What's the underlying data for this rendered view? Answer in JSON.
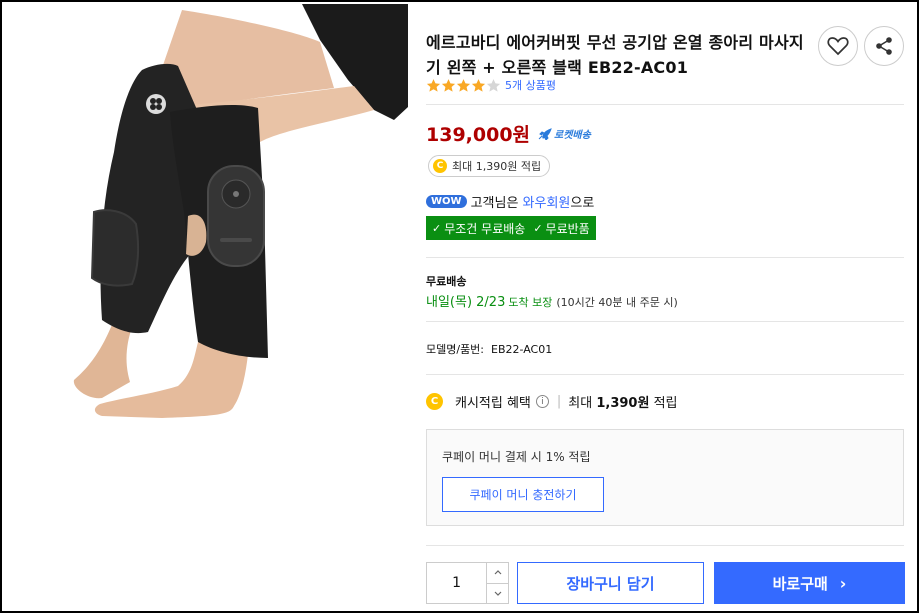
{
  "product": {
    "title": "에르고바디 에어커버핏 무선 공기압 온열 종아리 마사지기 왼쪽 + 오른쪽 블랙 EB22-AC01",
    "rating_stars": 4,
    "review_count": "5개 상품평",
    "price": "139,000원",
    "rocket_label": "로켓배송",
    "reward_pill": "최대 1,390원 적립",
    "wow": {
      "badge": "WOW",
      "text_before": "고객님은 ",
      "link": "와우회원",
      "text_after": "으로"
    },
    "benefits": [
      "무조건 무료배송",
      "무료반품"
    ],
    "shipping": {
      "label": "무료배송",
      "arrival_date": "내일(목) 2/23",
      "arrival_guarantee": "도착 보장",
      "note": "(10시간 40분 내 주문 시)"
    },
    "model": "모델명/품번:  EB22-AC01",
    "cash": {
      "label": "캐시적립 혜택",
      "max_prefix": "최대 ",
      "amount": "1,390원",
      "suffix": " 적립"
    },
    "coupay": {
      "text": "쿠페이 머니 결제 시 1% 적립",
      "button": "쿠페이 머니 충전하기"
    },
    "quantity": "1",
    "cart_button": "장바구니 담기",
    "buy_button": "바로구매",
    "icons": {
      "heart": "heart-icon",
      "share": "share-icon",
      "coin": "C",
      "info": "i",
      "chevron": "›"
    }
  },
  "colors": {
    "price": "#ae0000",
    "accent_blue": "#346aff",
    "benefit_green": "#0a8f12",
    "star": "#f9a825",
    "coin": "#ffc400"
  }
}
